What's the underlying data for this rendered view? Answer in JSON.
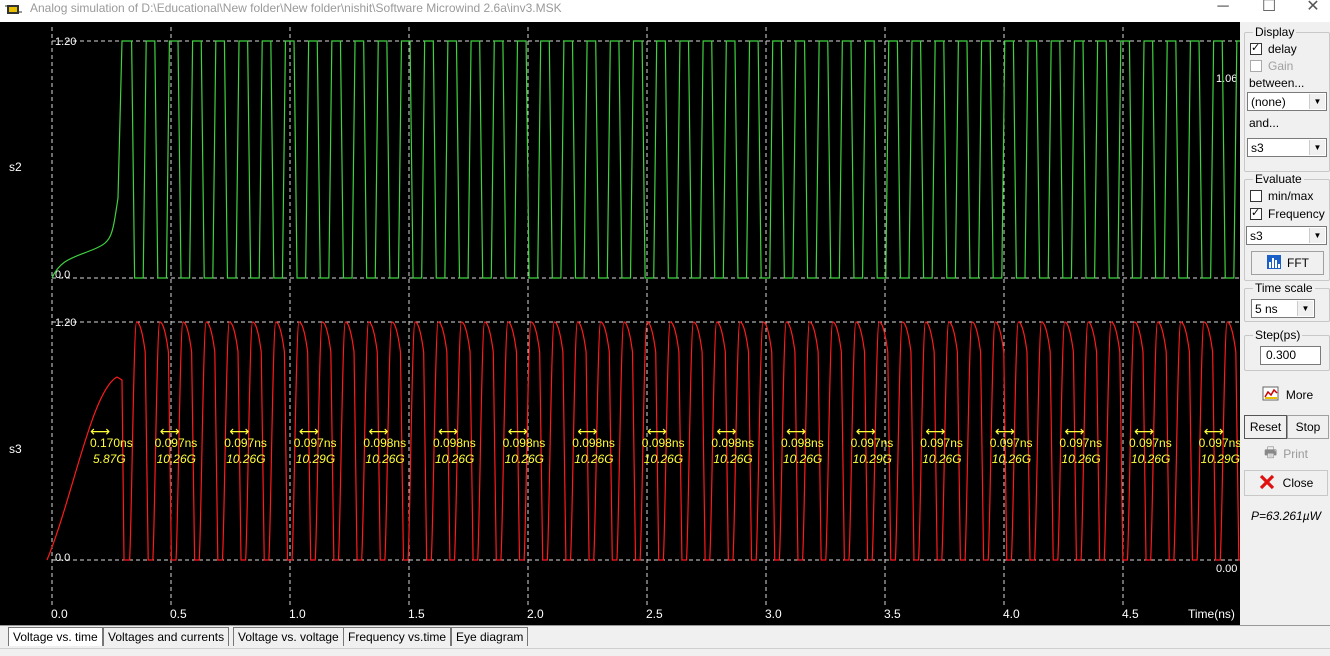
{
  "window": {
    "title": "Analog simulation of D:\\Educational\\New folder\\New folder\\nishit\\Software Microwind 2.6a\\inv3.MSK",
    "minimize": "─",
    "maximize": "☐",
    "close": "✕"
  },
  "plot": {
    "signal_labels": [
      "s2",
      "s3"
    ],
    "top_y_labels": {
      "high": "1.20",
      "low": "0.0",
      "right_readout": "1.06"
    },
    "bottom_y_labels": {
      "high": "1.20",
      "low": "0.0",
      "right_readout": "0.00"
    },
    "x_tick_labels": [
      "0.0",
      "0.5",
      "1.0",
      "1.5",
      "2.0",
      "2.5",
      "3.0",
      "3.5",
      "4.0",
      "4.5"
    ],
    "x_axis_label": "Time(ns)",
    "delay_arrow_glyph": "⟷",
    "measurements": [
      {
        "delay": "0.170ns",
        "freq": "5.87G"
      },
      {
        "delay": "0.097ns",
        "freq": "10.26G"
      },
      {
        "delay": "0.097ns",
        "freq": "10.26G"
      },
      {
        "delay": "0.097ns",
        "freq": "10.29G"
      },
      {
        "delay": "0.098ns",
        "freq": "10.26G"
      },
      {
        "delay": "0.098ns",
        "freq": "10.26G"
      },
      {
        "delay": "0.098ns",
        "freq": "10.26G"
      },
      {
        "delay": "0.098ns",
        "freq": "10.26G"
      },
      {
        "delay": "0.098ns",
        "freq": "10.26G"
      },
      {
        "delay": "0.098ns",
        "freq": "10.26G"
      },
      {
        "delay": "0.098ns",
        "freq": "10.26G"
      },
      {
        "delay": "0.097ns",
        "freq": "10.29G"
      },
      {
        "delay": "0.097ns",
        "freq": "10.26G"
      },
      {
        "delay": "0.097ns",
        "freq": "10.26G"
      },
      {
        "delay": "0.097ns",
        "freq": "10.26G"
      },
      {
        "delay": "0.097ns",
        "freq": "10.26G"
      },
      {
        "delay": "0.097ns",
        "freq": "10.29G"
      }
    ],
    "colors": {
      "background": "#000000",
      "s2": "#3fd23f",
      "s3": "#ff1a1a",
      "grid": "#d8d8d8",
      "annotation": "#ffff3a",
      "labels": "#ffffff"
    }
  },
  "chart_data": [
    {
      "type": "line",
      "series": [
        {
          "name": "s2",
          "description_values": {
            "x_start_ns": 0.0,
            "x_end_ns": 5.0,
            "ymin": 0.0,
            "ymax": 1.2
          }
        }
      ],
      "ylim": [
        0.0,
        1.2
      ],
      "xlim": [
        0.0,
        5.0
      ],
      "xlabel": "Time(ns)",
      "yticks": [
        "0.0",
        "1.20"
      ],
      "xticks": [
        "0.0",
        "0.5",
        "1.0",
        "1.5",
        "2.0",
        "2.5",
        "3.0",
        "3.5",
        "4.0",
        "4.5"
      ],
      "oscillation_period_ns": 0.0975,
      "startup_ns": 0.27,
      "grid": true
    },
    {
      "type": "line",
      "series": [
        {
          "name": "s3",
          "description_values": {
            "x_start_ns": 0.0,
            "x_end_ns": 5.0,
            "ymin": 0.0,
            "ymax": 1.2
          }
        }
      ],
      "ylim": [
        0.0,
        1.2
      ],
      "xlim": [
        0.0,
        5.0
      ],
      "xlabel": "Time(ns)",
      "yticks": [
        "0.0",
        "1.20"
      ],
      "xticks": [
        "0.0",
        "0.5",
        "1.0",
        "1.5",
        "2.0",
        "2.5",
        "3.0",
        "3.5",
        "4.0",
        "4.5"
      ],
      "oscillation_period_ns": 0.0975,
      "startup_ns": 0.27,
      "grid": true
    }
  ],
  "panel": {
    "display_label": "Display",
    "delay_label": "delay",
    "delay_checked": true,
    "gain_label": "Gain",
    "gain_checked": false,
    "between_label": "between...",
    "between_value": "(none)",
    "and_label": "and...",
    "and_value": "s3",
    "evaluate_label": "Evaluate",
    "minmax_label": "min/max",
    "minmax_checked": false,
    "frequency_label": "Frequency",
    "frequency_checked": true,
    "evaluate_signal": "s3",
    "fft_label": "FFT",
    "timescale_label": "Time scale",
    "timescale_value": "5 ns",
    "step_label": "Step(ps)",
    "step_value": "0.300",
    "more_label": "More",
    "reset_label": "Reset",
    "stop_label": "Stop",
    "print_label": "Print",
    "close_label": "Close",
    "power_text": "P=63.261µW"
  },
  "tabs": [
    {
      "label": "Voltage vs. time",
      "active": true
    },
    {
      "label": "Voltages and currents",
      "active": false
    },
    {
      "label": "Voltage vs. voltage",
      "active": false
    },
    {
      "label": "Frequency vs.time",
      "active": false
    },
    {
      "label": "Eye diagram",
      "active": false
    }
  ]
}
